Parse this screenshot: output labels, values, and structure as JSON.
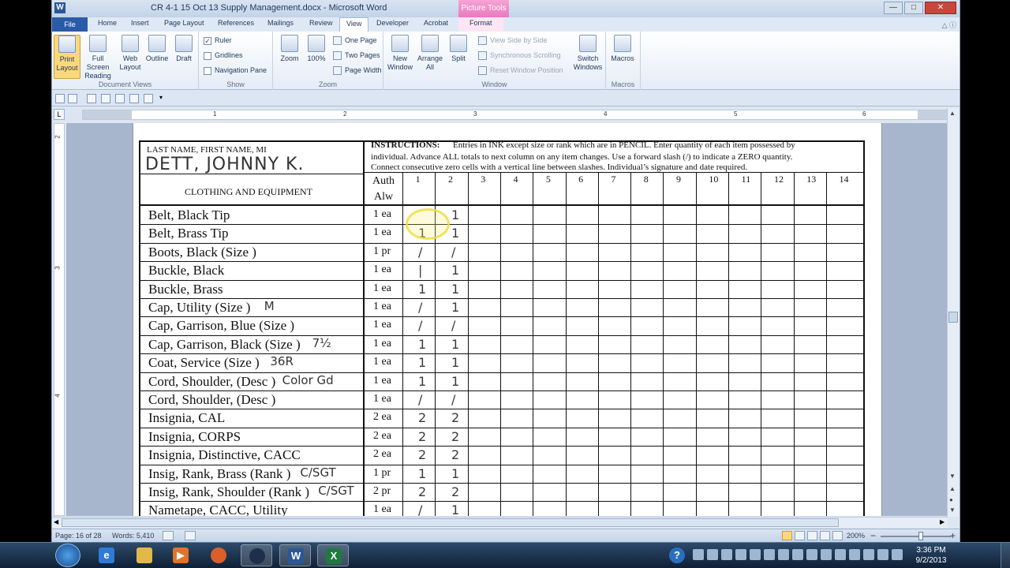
{
  "window": {
    "title": "CR 4-1 15 Oct 13 Supply Management.docx - Microsoft Word",
    "contextual_tab_group": "Picture Tools"
  },
  "tabs": [
    "File",
    "Home",
    "Insert",
    "Page Layout",
    "References",
    "Mailings",
    "Review",
    "View",
    "Developer",
    "Acrobat",
    "Format"
  ],
  "ribbon": {
    "document_views": {
      "label": "Document Views",
      "print_layout": "Print Layout",
      "full_screen_reading": "Full Screen Reading",
      "web_layout": "Web Layout",
      "outline": "Outline",
      "draft": "Draft"
    },
    "show": {
      "label": "Show",
      "ruler": "Ruler",
      "gridlines": "Gridlines",
      "navigation_pane": "Navigation Pane"
    },
    "zoom": {
      "label": "Zoom",
      "zoom": "Zoom",
      "hundred": "100%",
      "one_page": "One Page",
      "two_pages": "Two Pages",
      "page_width": "Page Width"
    },
    "window": {
      "label": "Window",
      "new_window": "New Window",
      "arrange_all": "Arrange All",
      "split": "Split",
      "view_side_by_side": "View Side by Side",
      "synchronous_scrolling": "Synchronous Scrolling",
      "reset_window_position": "Reset Window Position",
      "switch_windows": "Switch Windows"
    },
    "macros": {
      "label": "Macros",
      "macros": "Macros"
    }
  },
  "ruler": {
    "h_numbers": [
      "1",
      "2",
      "3",
      "4",
      "5",
      "6"
    ],
    "v_numbers": [
      "2",
      "3",
      "4"
    ]
  },
  "form": {
    "name_label": "LAST NAME, FIRST NAME, MI",
    "name_value": "DETT, JOHNNY K.",
    "instructions_label": "INSTRUCTIONS:",
    "instructions_line1": "Entries in INK except size or rank which are in PENCIL.  Enter quantity of each item possessed by",
    "instructions_line2": "individual. Advance ALL totals to next column on any item changes. Use a forward slash (/) to indicate a ZERO quantity.",
    "instructions_line3": "Connect consecutive zero cells with a vertical line between slashes. Individual’s signature and date required.",
    "clothing_header": "CLOTHING AND EQUIPMENT",
    "auth_header_1": "Auth",
    "auth_header_2": "Alw",
    "columns": [
      "1",
      "2",
      "3",
      "4",
      "5",
      "6",
      "7",
      "8",
      "9",
      "10",
      "11",
      "12",
      "13",
      "14"
    ],
    "rows": [
      {
        "item": "Belt, Black Tip",
        "auth": "1 ea",
        "c1": "",
        "c2": "1"
      },
      {
        "item": "Belt, Brass Tip",
        "auth": "1 ea",
        "c1": "1",
        "c2": "1"
      },
      {
        "item": "Boots, Black (Size        )",
        "auth": "1 pr",
        "c1": "/",
        "c2": "/"
      },
      {
        "item": "Buckle, Black",
        "auth": "1 ea",
        "c1": "|",
        "c2": "1"
      },
      {
        "item": "Buckle, Brass",
        "auth": "1 ea",
        "c1": "1",
        "c2": "1"
      },
      {
        "item": "Cap, Utility (Size      )",
        "auth": "1 ea",
        "c1": "/",
        "c2": "1",
        "size": "M"
      },
      {
        "item": "Cap, Garrison, Blue (Size        )",
        "auth": "1 ea",
        "c1": "/",
        "c2": "/"
      },
      {
        "item": "Cap, Garrison, Black (Size      )",
        "auth": "1 ea",
        "c1": "1",
        "c2": "1",
        "size": "7½"
      },
      {
        "item": "Coat, Service (Size         )",
        "auth": "1 ea",
        "c1": "1",
        "c2": "1",
        "size": "36R"
      },
      {
        "item": "Cord, Shoulder, (Desc             )",
        "auth": "1 ea",
        "c1": "1",
        "c2": "1",
        "size": "Color Gd"
      },
      {
        "item": "Cord, Shoulder, (Desc              )",
        "auth": "1 ea",
        "c1": "/",
        "c2": "/"
      },
      {
        "item": "Insignia, CAL",
        "auth": "2 ea",
        "c1": "2",
        "c2": "2"
      },
      {
        "item": "Insignia, CORPS",
        "auth": "2 ea",
        "c1": "2",
        "c2": "2"
      },
      {
        "item": "Insignia, Distinctive, CACC",
        "auth": "2 ea",
        "c1": "2",
        "c2": "2"
      },
      {
        "item": "Insig, Rank, Brass (Rank          )",
        "auth": "1 pr",
        "c1": "1",
        "c2": "1",
        "size": "C/SGT"
      },
      {
        "item": "Insig, Rank, Shoulder (Rank          )",
        "auth": "2 pr",
        "c1": "2",
        "c2": "2",
        "size": "C/SGT"
      },
      {
        "item": "Nametape, CACC, Utility",
        "auth": "1 ea",
        "c1": "/",
        "c2": "1"
      }
    ]
  },
  "status_bar": {
    "page": "Page: 16 of 28",
    "words": "Words: 5,410",
    "zoom": "200%"
  },
  "taskbar": {
    "time": "3:36 PM",
    "date": "9/2/2013",
    "help": "?"
  },
  "colors": {
    "accent": "#2a5ba8",
    "picture_tools": "#e97ac0",
    "active_button": "#fbd87c"
  }
}
